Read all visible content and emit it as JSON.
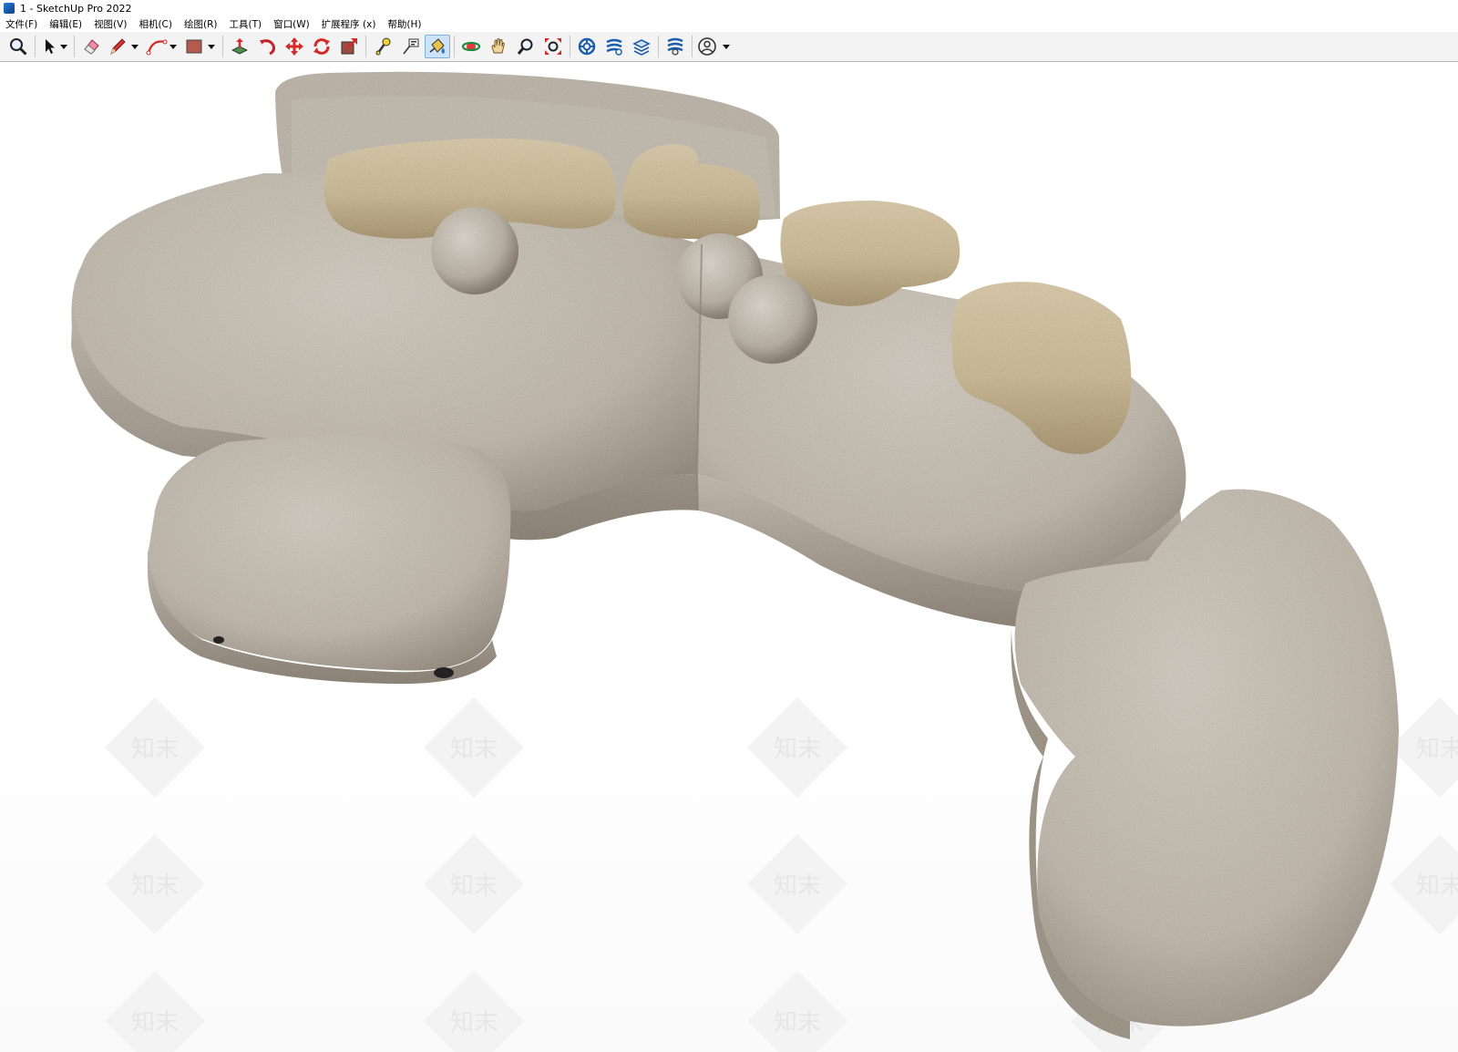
{
  "window": {
    "title": "1 - SketchUp Pro 2022",
    "icon": "sketchup-logo-icon"
  },
  "menu": [
    {
      "label": "文件(F)"
    },
    {
      "label": "编辑(E)"
    },
    {
      "label": "视图(V)"
    },
    {
      "label": "相机(C)"
    },
    {
      "label": "绘图(R)"
    },
    {
      "label": "工具(T)"
    },
    {
      "label": "窗口(W)"
    },
    {
      "label": "扩展程序 (x)"
    },
    {
      "label": "帮助(H)"
    }
  ],
  "toolbar": [
    {
      "icon": "zoom-icon"
    },
    {
      "icon": "select-arrow-icon",
      "dropdown": true
    },
    {
      "icon": "eraser-icon"
    },
    {
      "icon": "pencil-line-icon",
      "dropdown": true
    },
    {
      "icon": "arc-icon",
      "dropdown": true
    },
    {
      "icon": "rectangle-icon",
      "dropdown": true
    },
    {
      "icon": "push-pull-icon"
    },
    {
      "icon": "follow-me-icon"
    },
    {
      "icon": "move-icon"
    },
    {
      "icon": "rotate-icon"
    },
    {
      "icon": "scale-icon"
    },
    {
      "icon": "tape-measure-icon"
    },
    {
      "icon": "text-label-icon"
    },
    {
      "icon": "paint-bucket-icon",
      "active": true
    },
    {
      "icon": "orbit-icon"
    },
    {
      "icon": "pan-hand-icon"
    },
    {
      "icon": "zoom-window-icon"
    },
    {
      "icon": "zoom-extents-icon"
    },
    {
      "icon": "warehouse-icon"
    },
    {
      "icon": "extension-warehouse-icon"
    },
    {
      "icon": "layout-send-icon"
    },
    {
      "icon": "extension-manager-icon"
    },
    {
      "icon": "user-account-icon",
      "dropdown": true
    }
  ],
  "viewport": {
    "model": "curved-modular-sofa",
    "watermark_text": "知末",
    "colors": {
      "fabric": "#cdc6bb",
      "fabric_shadow": "#9f968a",
      "cushion": "#d8c9a8",
      "cushion_shadow": "#b4a27f"
    }
  }
}
